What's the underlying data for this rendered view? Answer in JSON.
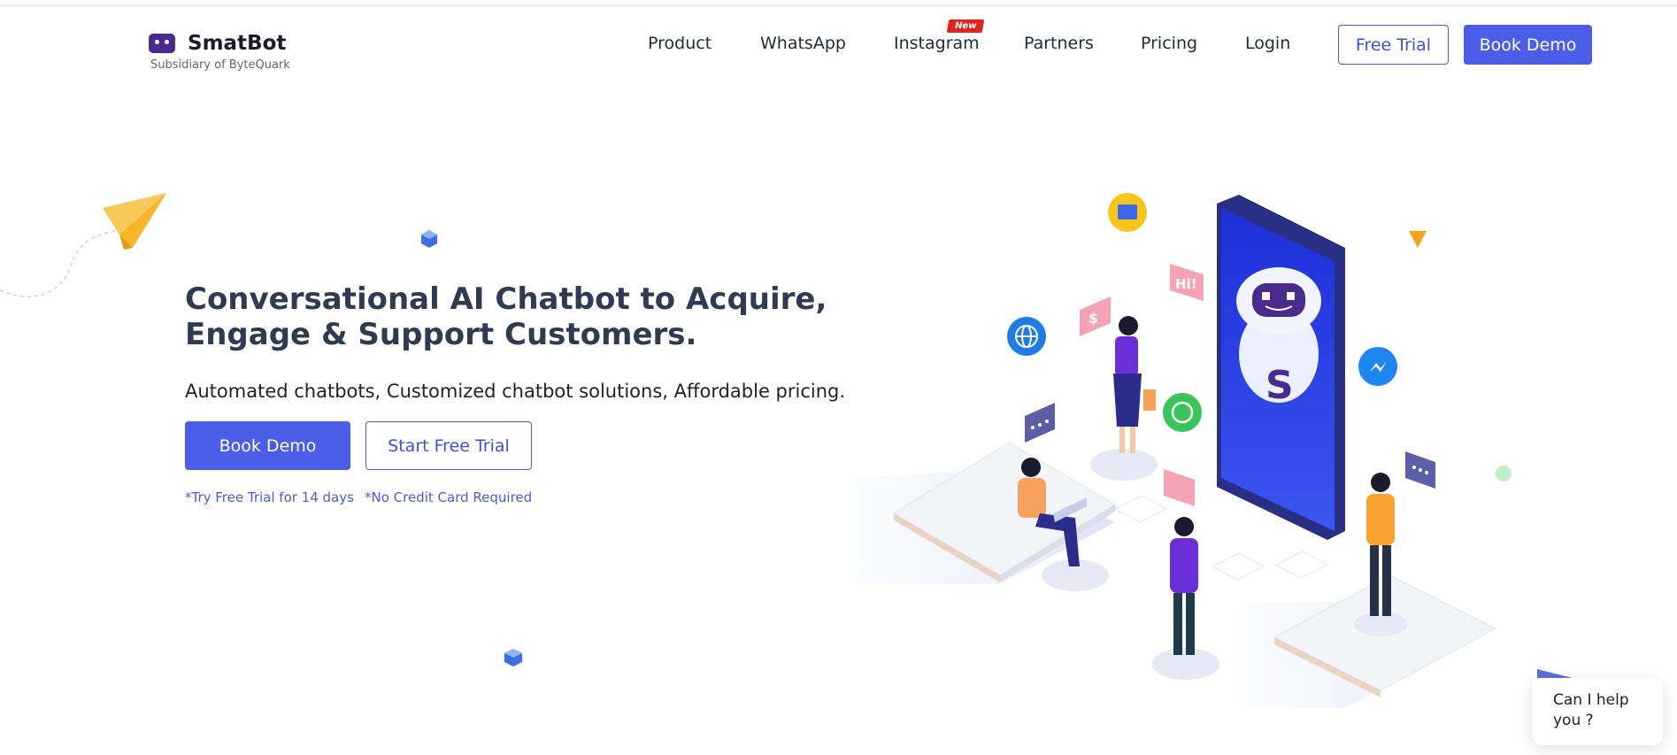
{
  "brand": {
    "name": "SmatBot",
    "subtitle": "Subsidiary of ByteQuark"
  },
  "nav": {
    "items": [
      {
        "label": "Product"
      },
      {
        "label": "WhatsApp"
      },
      {
        "label": "Instagram",
        "badge": "New"
      },
      {
        "label": "Partners"
      },
      {
        "label": "Pricing"
      },
      {
        "label": "Login"
      }
    ],
    "free_trial_label": "Free Trial",
    "book_demo_label": "Book Demo"
  },
  "hero": {
    "title": "Conversational AI Chatbot to Acquire, Engage & Support Customers.",
    "subtitle": "Automated chatbots, Customized chatbot solutions, Affordable pricing.",
    "book_demo_label": "Book Demo",
    "start_trial_label": "Start Free Trial",
    "note_trial": "*Try Free Trial for 14 days",
    "note_card": "*No Credit Card Required"
  },
  "illustration": {
    "bubble_hi": "Hi!",
    "bubble_dollar": "$"
  },
  "chat_widget": {
    "text": "Can I help you ?"
  },
  "colors": {
    "primary": "#4a5ee8",
    "text_dark": "#2f3b52",
    "badge_red": "#e0241f",
    "logo_purple": "#4a2a8c"
  }
}
